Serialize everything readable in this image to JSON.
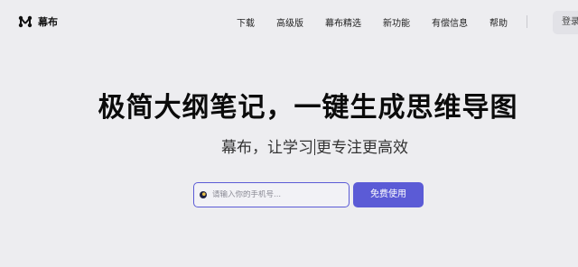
{
  "brand": {
    "name": "幕布"
  },
  "nav": {
    "items": [
      "下载",
      "高级版",
      "幕布精选",
      "新功能",
      "有偿信息",
      "帮助"
    ],
    "login_label": "登录"
  },
  "hero": {
    "title": "极简大纲笔记，一键生成思维导图",
    "subtitle_before": "幕布，让学习",
    "subtitle_after": "更专注更高效"
  },
  "signup": {
    "phone_placeholder": "请输入你的手机号...",
    "button_label": "免费使用"
  },
  "colors": {
    "accent": "#5b5bd6",
    "background": "#ededf0"
  }
}
